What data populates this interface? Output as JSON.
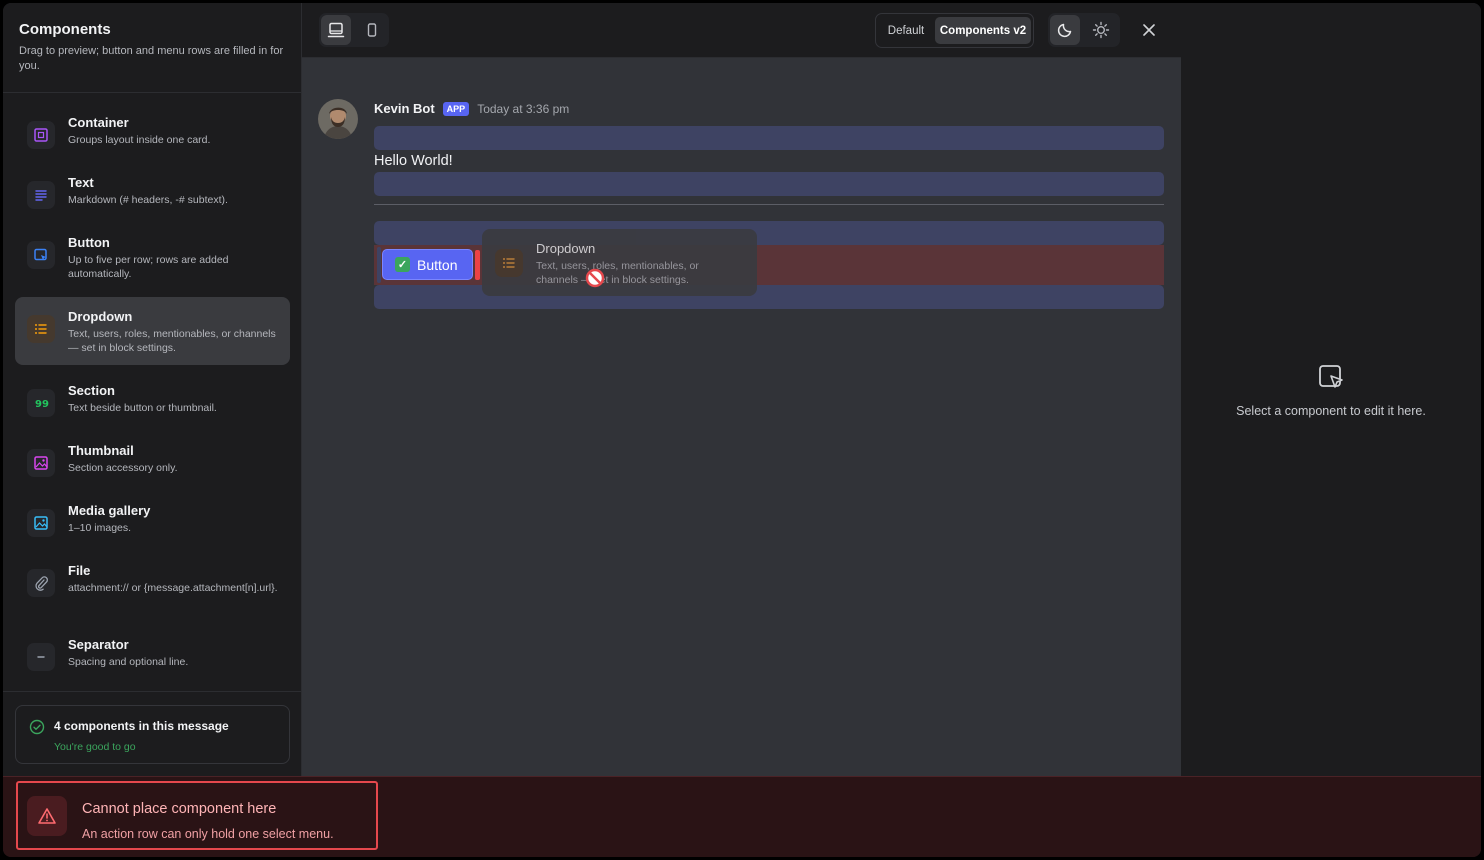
{
  "sidebar": {
    "title": "Components",
    "subtitle": "Drag to preview; button and menu rows are filled in for you.",
    "items": [
      {
        "name": "Container",
        "desc": "Groups layout inside one card.",
        "icon": "container-icon",
        "color": "#a855f7"
      },
      {
        "name": "Text",
        "desc": "Markdown (# headers, -# subtext).",
        "icon": "text-icon",
        "color": "#6366f1"
      },
      {
        "name": "Button",
        "desc": "Up to five per row; rows are added automatically.",
        "icon": "button-icon",
        "color": "#3b82f6"
      },
      {
        "name": "Dropdown",
        "desc": "Text, users, roles, mentionables, or channels — set in block settings.",
        "icon": "dropdown-icon",
        "color": "#f59e0b"
      },
      {
        "name": "Section",
        "desc": "Text beside button or thumbnail.",
        "icon": "section-icon",
        "color": "#22c55e"
      },
      {
        "name": "Thumbnail",
        "desc": "Section accessory only.",
        "icon": "thumbnail-icon",
        "color": "#d946ef"
      },
      {
        "name": "Media gallery",
        "desc": "1–10 images.",
        "icon": "media-gallery-icon",
        "color": "#38bdf8"
      },
      {
        "name": "File",
        "desc": "attachment:// or {message.attachment[n].url}.",
        "icon": "paperclip-icon",
        "color": "#9ca3af"
      },
      {
        "name": "Separator",
        "desc": "Spacing and optional line.",
        "icon": "separator-icon",
        "color": "#9ca3af"
      }
    ],
    "status": {
      "count_text": "4 components in this message",
      "ok_text": "You're good to go"
    }
  },
  "toolbar": {
    "mode_default": "Default",
    "mode_v2": "Components v2"
  },
  "message": {
    "author": "Kevin Bot",
    "badge": "APP",
    "time": "Today at 3:36 pm",
    "text": "Hello World!",
    "button_label": "Button",
    "ghost_name": "Dropdown",
    "ghost_desc": "Text, users, roles, mentionables, or channels — set in block settings."
  },
  "inspector": {
    "empty_text": "Select a component to edit it here."
  },
  "alert": {
    "title": "Cannot place component here",
    "desc": "An action row can only hold one select menu."
  }
}
